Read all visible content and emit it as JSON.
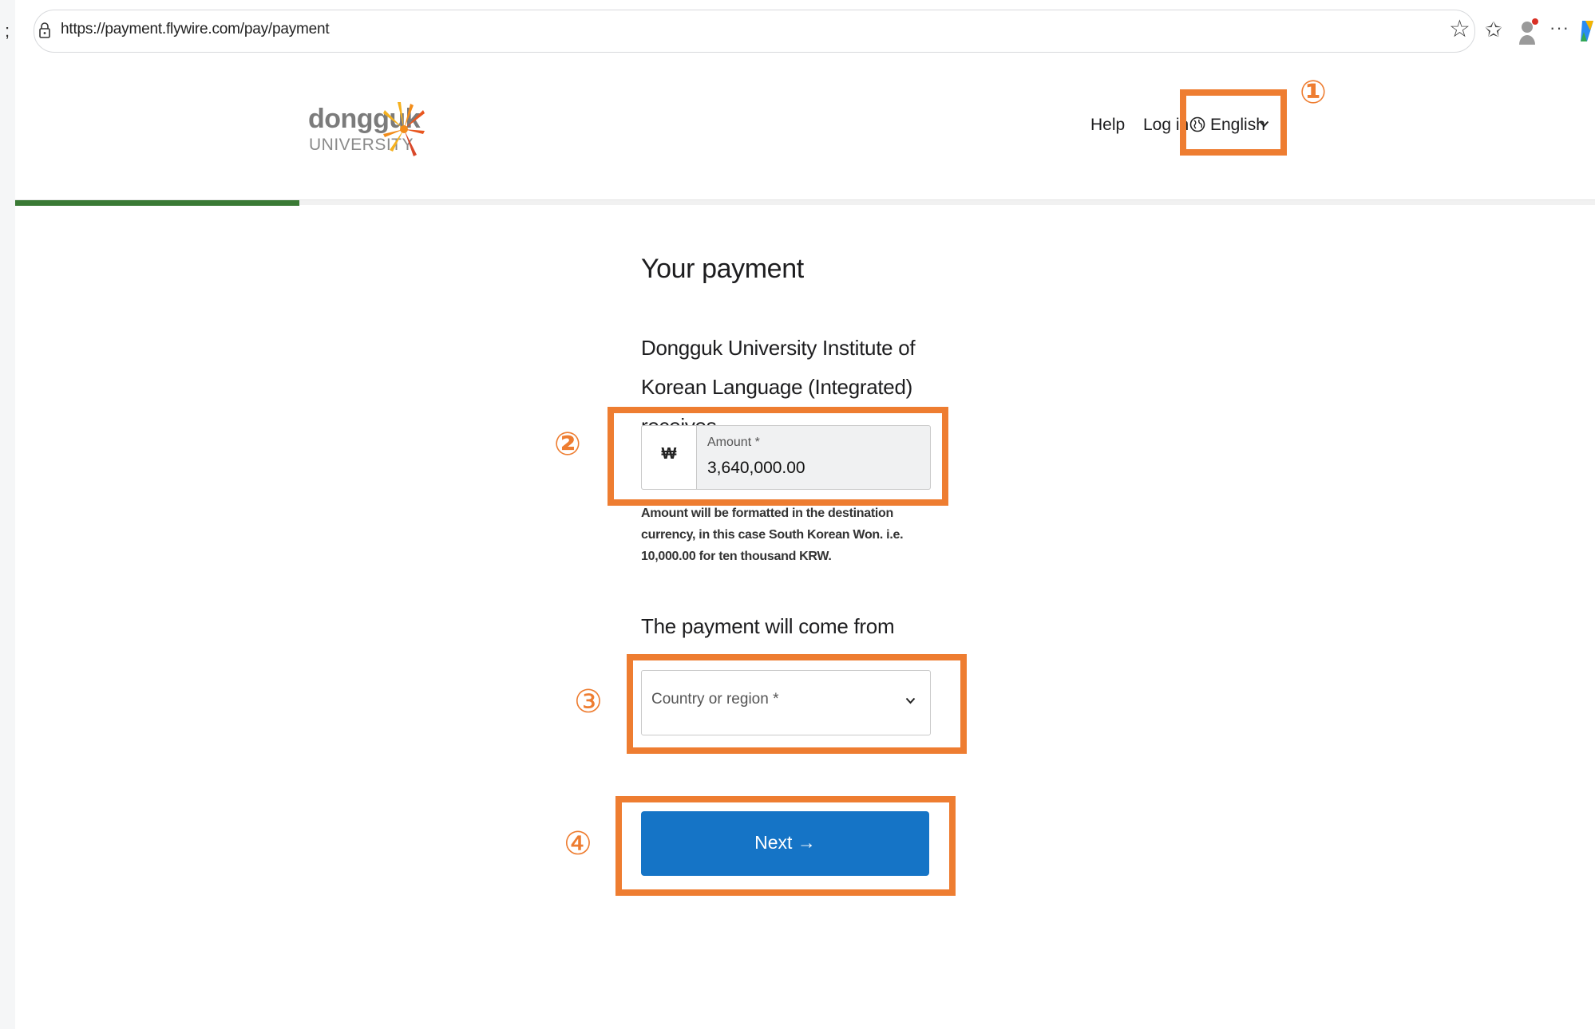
{
  "browser": {
    "url": "https://payment.flywire.com/pay/payment",
    "more_label": "···"
  },
  "header": {
    "logo_word": "dongguk",
    "logo_sub": "UNIVERSITY",
    "nav": {
      "help": "Help",
      "login": "Log in",
      "language": "English"
    },
    "progress": 0.18
  },
  "main": {
    "title": "Your payment",
    "receiver": "Dongguk University Institute of Korean Language (Integrated) receives",
    "amount": {
      "currency_symbol": "₩",
      "label": "Amount *",
      "value": "3,640,000.00",
      "helper": "Amount will be formatted in the destination currency, in this case South Korean Won. i.e. 10,000.00 for ten thousand KRW."
    },
    "from": {
      "label": "The payment will come from",
      "select_placeholder": "Country or region *"
    },
    "next_button": "Next →"
  },
  "annotations": {
    "markers": [
      "①",
      "②",
      "③",
      "④"
    ],
    "color": "#ee7d31"
  },
  "colors": {
    "primary_button": "#1574c6",
    "progress": "#3a7a35",
    "annotation": "#ee7d31"
  }
}
